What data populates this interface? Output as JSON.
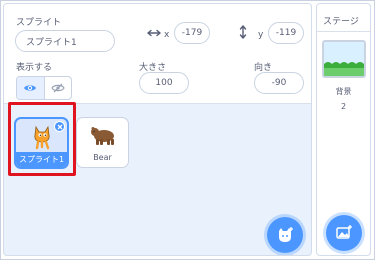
{
  "sprite_info": {
    "sprite_label": "スプライト",
    "sprite_name": "スプライト1",
    "x_label": "x",
    "x_value": "-179",
    "y_label": "y",
    "y_value": "-119",
    "show_label": "表示する",
    "size_label": "大きさ",
    "size_value": "100",
    "direction_label": "向き",
    "direction_value": "-90"
  },
  "sprites": [
    {
      "name": "スプライト1",
      "selected": true
    },
    {
      "name": "Bear",
      "selected": false
    }
  ],
  "stage": {
    "title": "ステージ",
    "backdrops_label": "背景",
    "backdrops_count": "2"
  },
  "colors": {
    "accent": "#4c97ff",
    "highlight": "#e0141e",
    "panel_bg": "#e9f1fc",
    "text": "#575e75"
  }
}
